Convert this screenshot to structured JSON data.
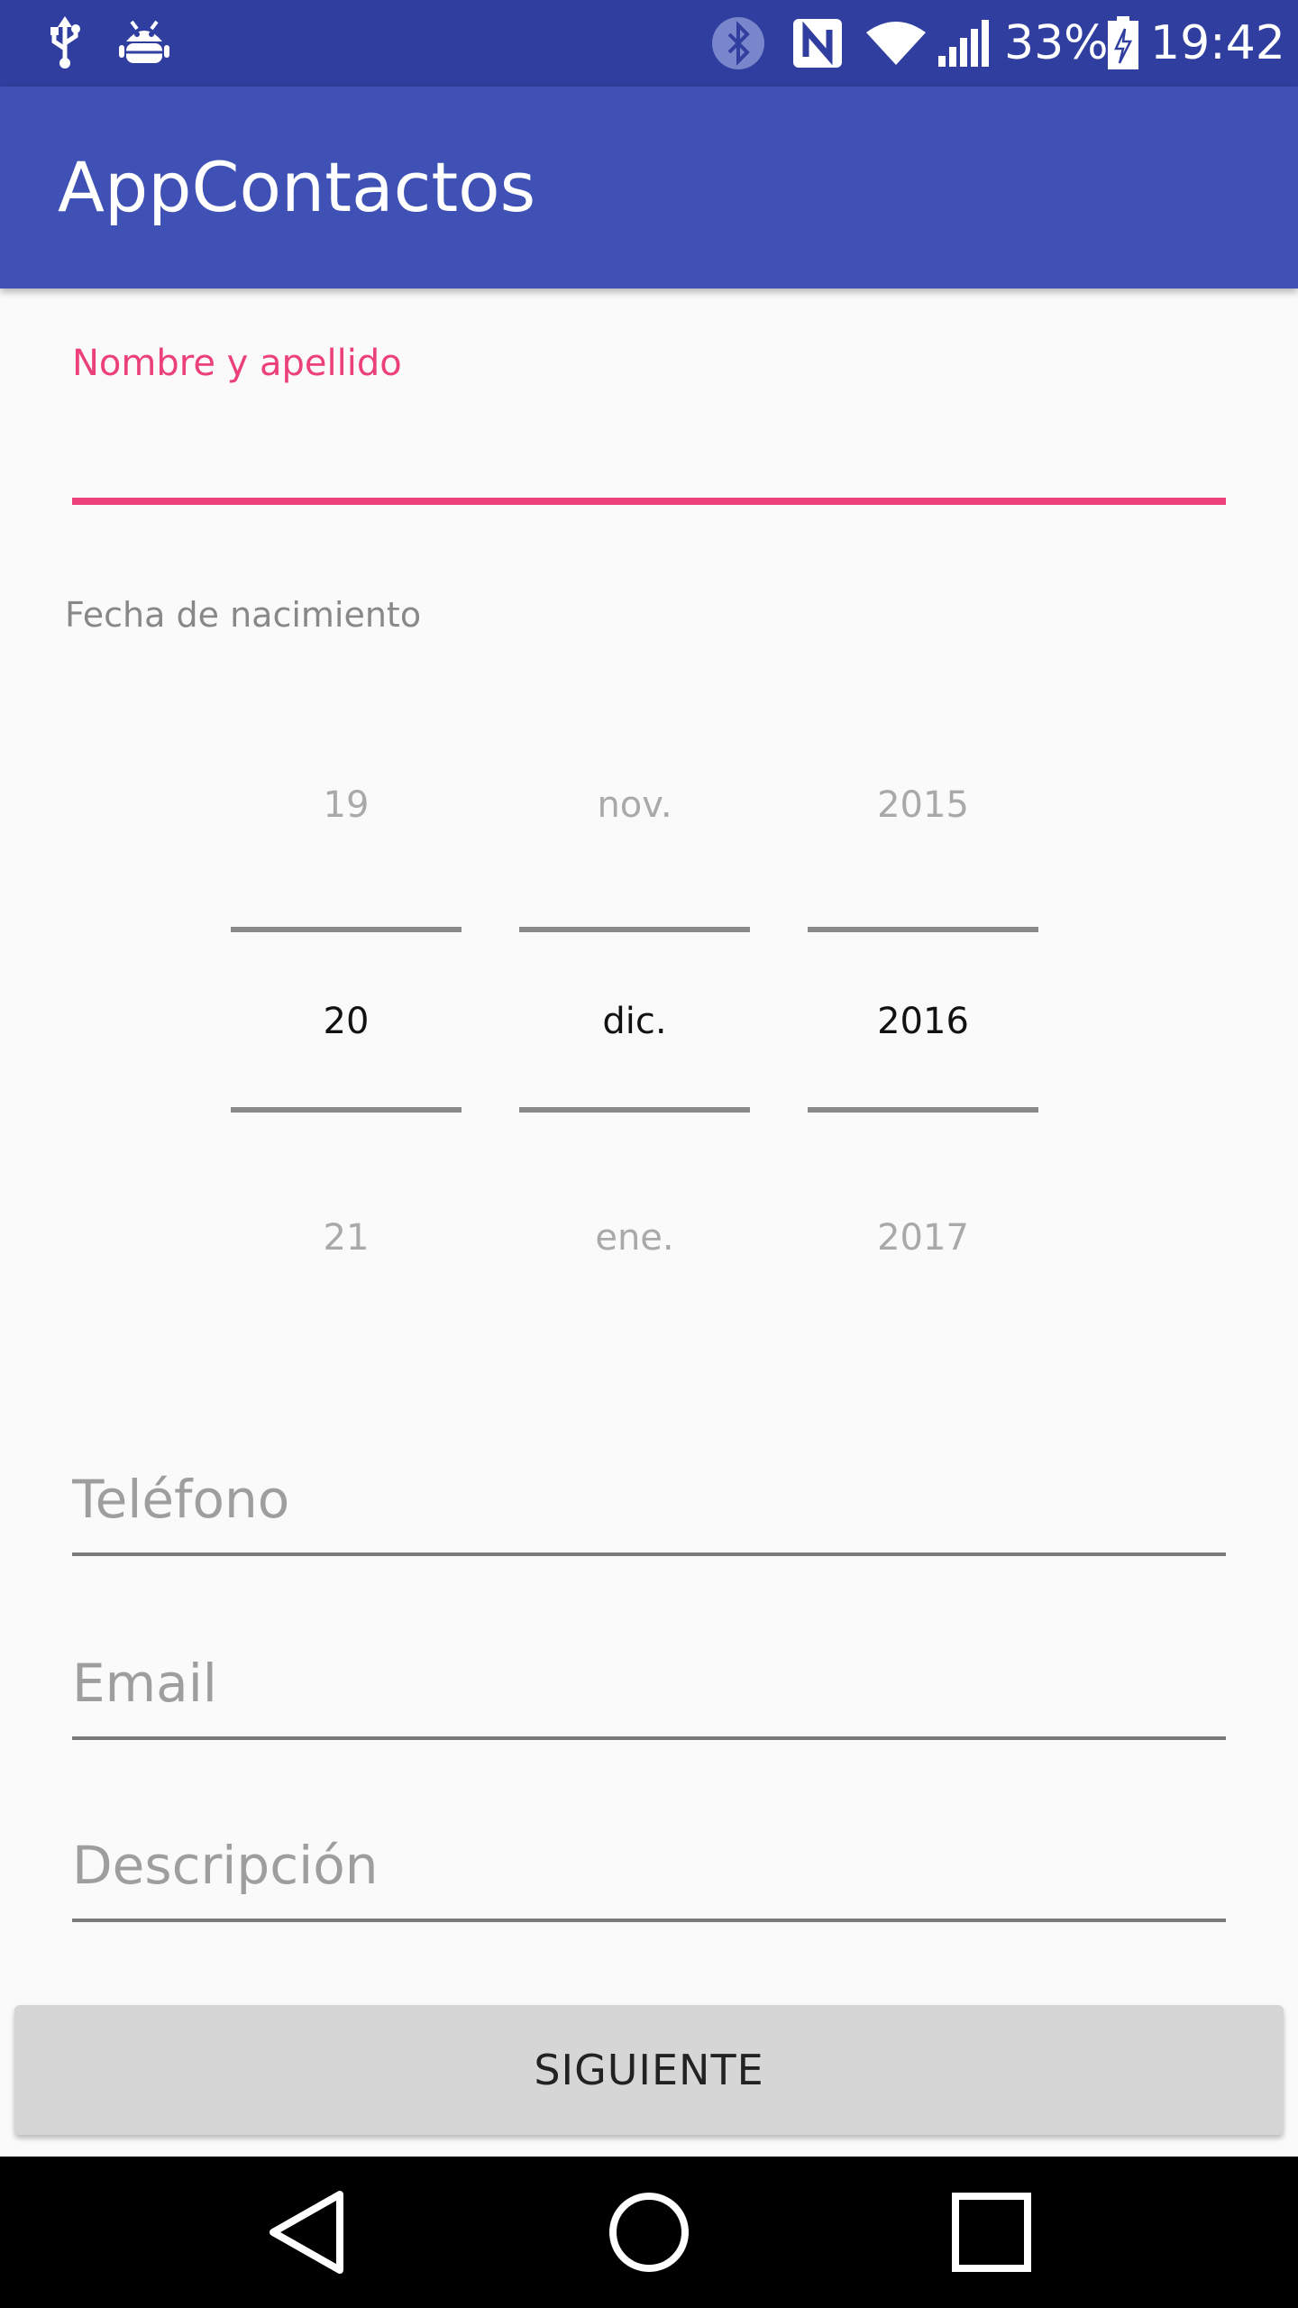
{
  "status_bar": {
    "battery": "33%",
    "time": "19:42",
    "icons": [
      "usb-icon",
      "android-debug-icon",
      "bluetooth-icon",
      "nfc-icon",
      "wifi-icon",
      "signal-icon",
      "battery-charging-icon"
    ]
  },
  "app_bar": {
    "title": "AppContactos"
  },
  "name_field": {
    "label": "Nombre y apellido",
    "value": ""
  },
  "birth_date": {
    "label": "Fecha de nacimiento",
    "day": {
      "prev": "19",
      "current": "20",
      "next": "21"
    },
    "month": {
      "prev": "nov.",
      "current": "dic.",
      "next": "ene."
    },
    "year": {
      "prev": "2015",
      "current": "2016",
      "next": "2017"
    }
  },
  "phone_field": {
    "placeholder": "Teléfono"
  },
  "email_field": {
    "placeholder": "Email"
  },
  "description_field": {
    "placeholder": "Descripción"
  },
  "next_button": {
    "label": "SIGUIENTE"
  },
  "nav_bar": {
    "icons": [
      "back-icon",
      "home-icon",
      "recents-icon"
    ]
  },
  "colors": {
    "status_bar": "#303f9f",
    "app_bar": "#3f51b5",
    "accent": "#ec407a",
    "background": "#fafafa",
    "button": "#d6d6d6"
  }
}
